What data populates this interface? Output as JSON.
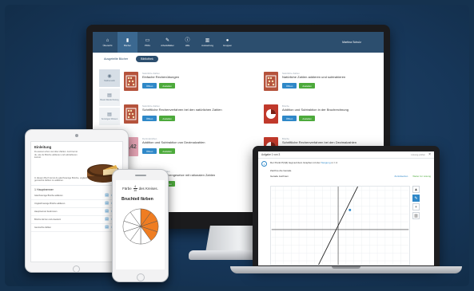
{
  "colors": {
    "background": "#15324f",
    "nav": "#2c4e6e",
    "primary_button": "#2f88c8",
    "secondary_button": "#4daa3c",
    "pie_orange": "#ef7d22"
  },
  "monitor": {
    "nav": {
      "items": [
        {
          "icon": "home-icon",
          "glyph": "⌂",
          "label": "Übersicht"
        },
        {
          "icon": "books-icon",
          "glyph": "▮",
          "label": "Bücher"
        },
        {
          "icon": "file-icon",
          "glyph": "▭",
          "label": "PDFs"
        },
        {
          "icon": "notes-icon",
          "glyph": "✎",
          "label": "Arbeitsblätter"
        },
        {
          "icon": "info-icon",
          "glyph": "ⓘ",
          "label": "Hilfe"
        },
        {
          "icon": "chart-icon",
          "glyph": "▥",
          "label": "Auswertung"
        },
        {
          "icon": "user-icon",
          "glyph": "●",
          "label": "Gruppen"
        }
      ],
      "user": "Martina Schulz"
    },
    "tabs": [
      "Ausgeteilte Bücher",
      "Bibliothek"
    ],
    "sidebar": [
      {
        "icon": "eye-icon",
        "glyph": "◉",
        "label": "Mathematik"
      },
      {
        "icon": "book-icon",
        "glyph": "▤",
        "label": "Basis-Wiederholung"
      },
      {
        "icon": "book-icon",
        "glyph": "▤",
        "label": "Sonstiges Wissen"
      }
    ],
    "cards": [
      {
        "category": "Natürliche Zahlen",
        "title": "Einfache Rechenübungen",
        "image": "abacus",
        "color": "#b5533c"
      },
      {
        "category": "Natürliche Zahlen",
        "title": "Natürliche Zahlen addieren und subtrahieren",
        "image": "abacus",
        "color": "#b5533c"
      },
      {
        "category": "Natürliche Zahlen",
        "title": "Schriftliche Rechenverfahren bei den natürlichen Zahlen",
        "image": "abacus",
        "color": "#b5533c"
      },
      {
        "category": "Brüche",
        "title": "Addition und Subtraktion in der Bruchrechnung",
        "image": "pie",
        "color": "#c0392b"
      },
      {
        "category": "Dezimalzahlen",
        "title": "Addition und Subtraktion von Dezimalzahlen",
        "image": "0,42",
        "color": "#e3a3b3"
      },
      {
        "category": "Brüche",
        "title": "Schriftliche Rechenverfahren bei den Dezimalzahlen",
        "image": "pie",
        "color": "#c0392b"
      },
      {
        "category": "Ganze und rationale Zahlen",
        "title": "Rechnen und Rechengesetze mit rationalen Zahlen",
        "image": "scale",
        "color": "#c9c9c9"
      }
    ],
    "btn_open": "Öffnen",
    "btn_select": "Austeilen"
  },
  "tablet": {
    "heading": "Einleitung",
    "intro": "Du weisst schon viel über Zahlen. Jetzt lernst du, wie du Brüche addieren und subtrahieren kannst.",
    "hint": "In diesem Buch lernst du gleichnamige Brüche, ungleichnamige Brüche und gemischte Zahlen zu addieren.",
    "section": "1 Hauptnenner",
    "rows": [
      "Gleichnamige Brüche addieren",
      "Ungleichnamige Brüche addieren",
      "Hauptnenner bestimmen",
      "Brüche kürzen und erweitern",
      "Gemischte Zahlen"
    ]
  },
  "phone": {
    "instruction_pre": "Färbe",
    "fraction_num": "4",
    "fraction_den": "10",
    "instruction_post": "des Kreises.",
    "title": "Bruchteil färben",
    "slices_total": 10,
    "slices_colored": 4
  },
  "laptop": {
    "title": "Aufgabe 1 von 3",
    "hint": "Lösung prüfen",
    "task_number": "1",
    "task_text": "Der Punkt P(3|4) liegt auf dem Graphen mit der",
    "task_link": "Steigung",
    "task_end": "m = 2.",
    "sub": "Zeichne die Gerade.",
    "tool_title": "Gerade zeichnen",
    "reset": "Zurücksetzen",
    "next": "Weiter zur Lösung",
    "side_buttons": [
      {
        "icon": "cursor-icon",
        "glyph": "▲"
      },
      {
        "icon": "pen-icon",
        "glyph": "✎"
      },
      {
        "icon": "plus-icon",
        "glyph": "+"
      },
      {
        "icon": "trash-icon",
        "glyph": "▥"
      }
    ]
  }
}
